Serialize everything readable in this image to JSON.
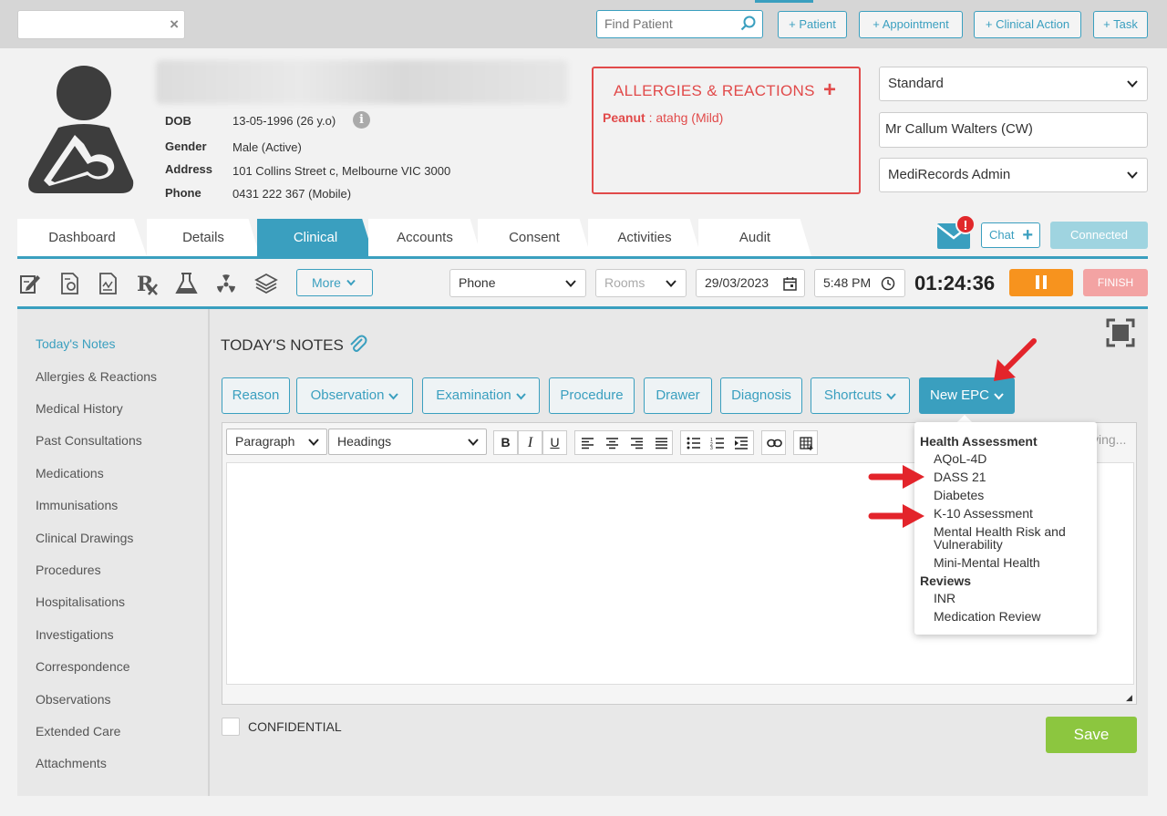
{
  "topbar": {
    "search_close": "×",
    "find_patient_placeholder": "Find Patient",
    "buttons": [
      "+ Patient",
      "+ Appointment",
      "+ Clinical Action",
      "+ Task"
    ]
  },
  "patient": {
    "dob_label": "DOB",
    "dob": "13-05-1996 (26 y.o)",
    "gender_label": "Gender",
    "gender": "Male (Active)",
    "address_label": "Address",
    "address": "101 Collins Street c, Melbourne VIC 3000",
    "phone_label": "Phone",
    "phone": "0431 222 367 (Mobile)",
    "info": "i"
  },
  "allergies": {
    "title": "ALLERGIES & REACTIONS",
    "add": "+",
    "item_name": "Peanut",
    "item_detail": " : atahg (Mild)"
  },
  "right_selects": {
    "billing": "Standard",
    "practitioner": "Mr Callum Walters (CW)",
    "location": "MediRecords Admin"
  },
  "tabs": [
    "Dashboard",
    "Details",
    "Clinical",
    "Accounts",
    "Consent",
    "Activities",
    "Audit"
  ],
  "active_tab": "Clinical",
  "header_actions": {
    "alert": "!",
    "chat": "Chat",
    "chat_plus": "+",
    "connected": "Connected"
  },
  "toolbar": {
    "more": "More",
    "type": "Phone",
    "rooms_placeholder": "Rooms",
    "date": "29/03/2023",
    "time": "5:48 PM",
    "timer": "01:24:36",
    "finish": "FINISH"
  },
  "sidebar": {
    "items": [
      "Today's Notes",
      "Allergies & Reactions",
      "Medical History",
      "Past Consultations",
      "Medications",
      "Immunisations",
      "Clinical Drawings",
      "Procedures",
      "Hospitalisations",
      "Investigations",
      "Correspondence",
      "Observations",
      "Extended Care",
      "Attachments"
    ],
    "active": "Today's Notes"
  },
  "notes": {
    "title": "TODAY'S NOTES",
    "buttons": [
      "Reason",
      "Observation",
      "Examination",
      "Procedure",
      "Drawer",
      "Diagnosis",
      "Shortcuts",
      "New EPC"
    ],
    "editor": {
      "paragraph": "Paragraph",
      "headings": "Headings",
      "bold": "B",
      "italic": "I",
      "underline": "U",
      "saving": "ving..."
    },
    "confidential": "CONFIDENTIAL",
    "save": "Save"
  },
  "epc_menu": {
    "groups": [
      {
        "heading": "Health Assessment",
        "items": [
          "AQoL-4D",
          "DASS 21",
          "Diabetes",
          "K-10 Assessment",
          "Mental Health Risk and Vulnerability",
          "Mini-Mental Health"
        ]
      },
      {
        "heading": "Reviews",
        "items": [
          "INR",
          "Medication Review"
        ]
      }
    ]
  },
  "colors": {
    "accent": "#3a9fbf",
    "allergy": "#e14a4a",
    "save": "#8cc63f",
    "pause": "#f7931e",
    "finish": "#f3a3a3",
    "arrow": "#e3242b"
  }
}
